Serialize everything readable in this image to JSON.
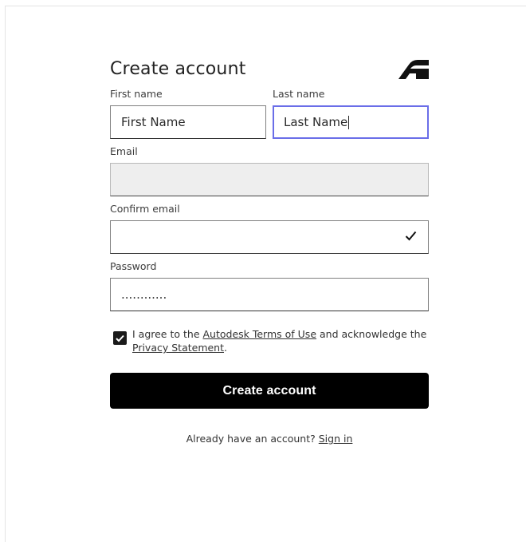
{
  "form": {
    "title": "Create account",
    "first_name_label": "First name",
    "last_name_label": "Last name",
    "first_name_placeholder": "First Name",
    "last_name_value": "Last Name",
    "email_label": "Email",
    "email_value": "",
    "confirm_email_label": "Confirm email",
    "confirm_email_value": "",
    "password_label": "Password",
    "password_mask": "............"
  },
  "agreement": {
    "checked": true,
    "text_1": "I agree to the ",
    "terms_link": "Autodesk Terms of Use",
    "text_2": " and acknowledge the ",
    "privacy_link": "Privacy Statement",
    "text_3": "."
  },
  "actions": {
    "submit_label": "Create account",
    "signin_prompt": "Already have an account? ",
    "signin_link": "Sign in"
  },
  "icons": {
    "brand_logo": "autodesk-logo-icon",
    "confirm_status": "checkmark-icon",
    "agree_check": "checkbox-checked-icon"
  },
  "colors": {
    "focus_border": "#6a6ee8",
    "button_bg": "#000000",
    "disabled_bg": "#eeeeee"
  }
}
